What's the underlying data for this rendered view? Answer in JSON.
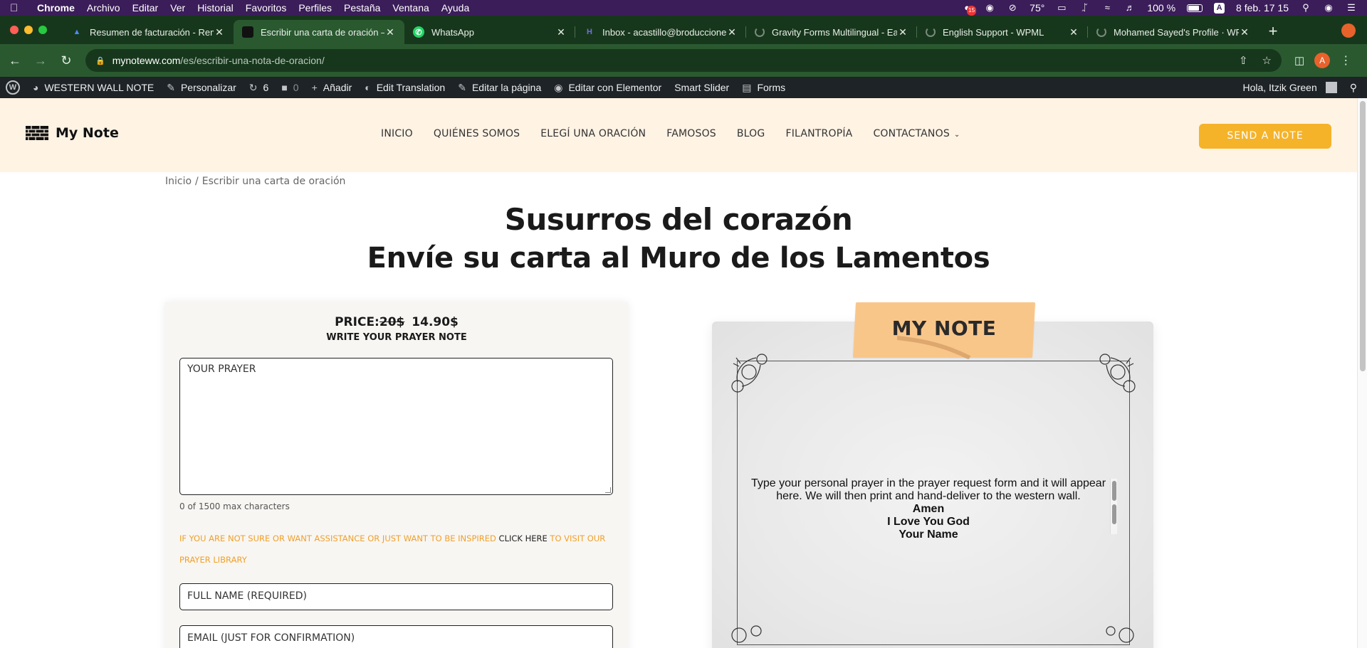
{
  "menubar": {
    "app": "Chrome",
    "items": [
      "Archivo",
      "Editar",
      "Ver",
      "Historial",
      "Favoritos",
      "Perfiles",
      "Pestaña",
      "Ventana",
      "Ayuda"
    ],
    "badge": "15",
    "temp": "75°",
    "battery": "100 %",
    "input_source": "A",
    "datetime": "8 feb.  17 15"
  },
  "tabs": [
    {
      "title": "Resumen de facturación - Rem",
      "fav_color": "#4a8af4"
    },
    {
      "title": "Escribir una carta de oración –",
      "fav_color": "#111111"
    },
    {
      "title": "WhatsApp",
      "fav_color": "#25d366"
    },
    {
      "title": "Inbox - acastillo@broducciones",
      "fav_color": "#5b5bd6"
    },
    {
      "title": "Gravity Forms Multilingual - Ea",
      "fav_color": "#7a8a7c"
    },
    {
      "title": "English Support - WPML",
      "fav_color": "#7a8a7c"
    },
    {
      "title": "Mohamed Sayed's Profile · WP",
      "fav_color": "#7a8a7c"
    }
  ],
  "address": {
    "host": "mynoteww.com",
    "path": "/es/escribir-una-nota-de-oracion/",
    "profile_initial": "A"
  },
  "wpbar": {
    "site": "WESTERN WALL NOTE",
    "customize": "Personalizar",
    "updates": "6",
    "comments": "0",
    "add": "Añadir",
    "edit_translation": "Edit Translation",
    "edit_page": "Editar la página",
    "elementor": "Editar con Elementor",
    "slider": "Smart Slider",
    "forms": "Forms",
    "greeting": "Hola, Itzik Green"
  },
  "header": {
    "logo": "My Note",
    "nav": [
      "INICIO",
      "QUIÉNES SOMOS",
      "ELEGÍ UNA ORACIÓN",
      "FAMOSOS",
      "BLOG",
      "FILANTROPÍA",
      "CONTACTANOS"
    ],
    "cta": "SEND A NOTE"
  },
  "breadcrumb": {
    "home": "Inicio",
    "current": "Escribir una carta de oración"
  },
  "title": "Susurros del corazón",
  "subtitle": "Envíe su carta al Muro de los Lamentos",
  "form": {
    "price_label": "PRICE:",
    "old_price": "20$",
    "new_price": "14.90$",
    "write_label": "WRITE YOUR PRAYER NOTE",
    "prayer_placeholder": "YOUR PRAYER",
    "char_count": "0 of 1500 max characters",
    "inspire_prefix": "IF YOU ARE NOT SURE OR WANT ASSISTANCE OR JUST WANT TO BE INSPIRED ",
    "inspire_link": "CLICK HERE",
    "inspire_suffix": " TO VISIT OUR PRAYER LIBRARY",
    "fullname_placeholder": "FULL NAME (REQUIRED)",
    "email_placeholder": "EMAIL (JUST FOR CONFIRMATION)"
  },
  "note": {
    "title": "MY NOTE",
    "body": "Type your personal prayer in the prayer request form and it will appear here. We will then print and hand-deliver to the western wall.",
    "amen": "Amen",
    "love": "I Love You God",
    "name": "Your Name"
  },
  "colors": {
    "accent": "#f5b32a",
    "header_bg": "#fff3e4",
    "tab_bg": "#17371c",
    "tab_active": "#2a5930",
    "wpbar": "#1d2327"
  }
}
